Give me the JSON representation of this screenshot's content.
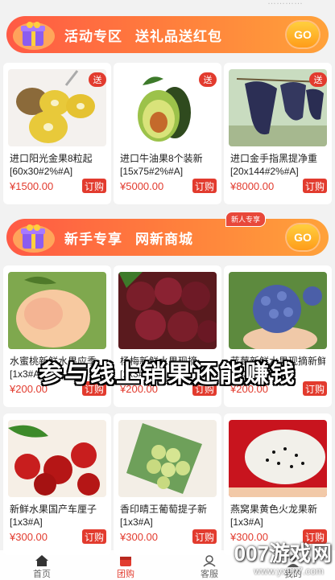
{
  "top": {
    "partial_text": "…………"
  },
  "banner1": {
    "title": "活动专区",
    "subtitle": "送礼品送红包",
    "go": "GO"
  },
  "banner2": {
    "title": "新手专享",
    "subtitle": "网新商城",
    "tag": "新人专享",
    "go": "GO"
  },
  "badge_text": "送",
  "buy_label": "订购",
  "row1": [
    {
      "name": "进口阳光金果8粒起",
      "spec": "[60x30#2%#A]",
      "price": "¥1500.00",
      "badge": true
    },
    {
      "name": "进口牛油果8个装新",
      "spec": "[15x75#2%#A]",
      "price": "¥5000.00",
      "badge": true
    },
    {
      "name": "进口金手指黑提净重",
      "spec": "[20x144#2%#A]",
      "price": "¥8000.00",
      "badge": true
    }
  ],
  "row2": [
    {
      "name": "水蜜桃新鲜水果应季",
      "spec": "[1x3#A]",
      "price": "¥200.00"
    },
    {
      "name": "杨梅新鲜水果现摘",
      "spec": "[1x3#A]",
      "price": "¥200.00"
    },
    {
      "name": "蓝莓新鲜水果现摘新鲜",
      "spec": "[1x3#A]",
      "price": "¥200.00"
    }
  ],
  "row3": [
    {
      "name": "新鲜水果国产车厘子",
      "spec": "[1x3#A]",
      "price": "¥300.00"
    },
    {
      "name": "香印晴王葡萄提子新",
      "spec": "[1x3#A]",
      "price": "¥300.00"
    },
    {
      "name": "燕窝果黄色火龙果新",
      "spec": "[1x3#A]",
      "price": "¥300.00"
    }
  ],
  "overlay_caption": "参与线上销果还能赚钱",
  "tabs": [
    {
      "label": "首页",
      "icon": "home-icon"
    },
    {
      "label": "团购",
      "icon": "store-icon"
    },
    {
      "label": "客服",
      "icon": "service-icon"
    },
    {
      "label": "我的",
      "icon": "user-icon"
    }
  ],
  "watermark": {
    "big": "007游戏网",
    "small": "www.yx007.com"
  },
  "colors": {
    "accent": "#e23b2e",
    "banner_start": "#ff5a45",
    "banner_end": "#ffa23a"
  }
}
